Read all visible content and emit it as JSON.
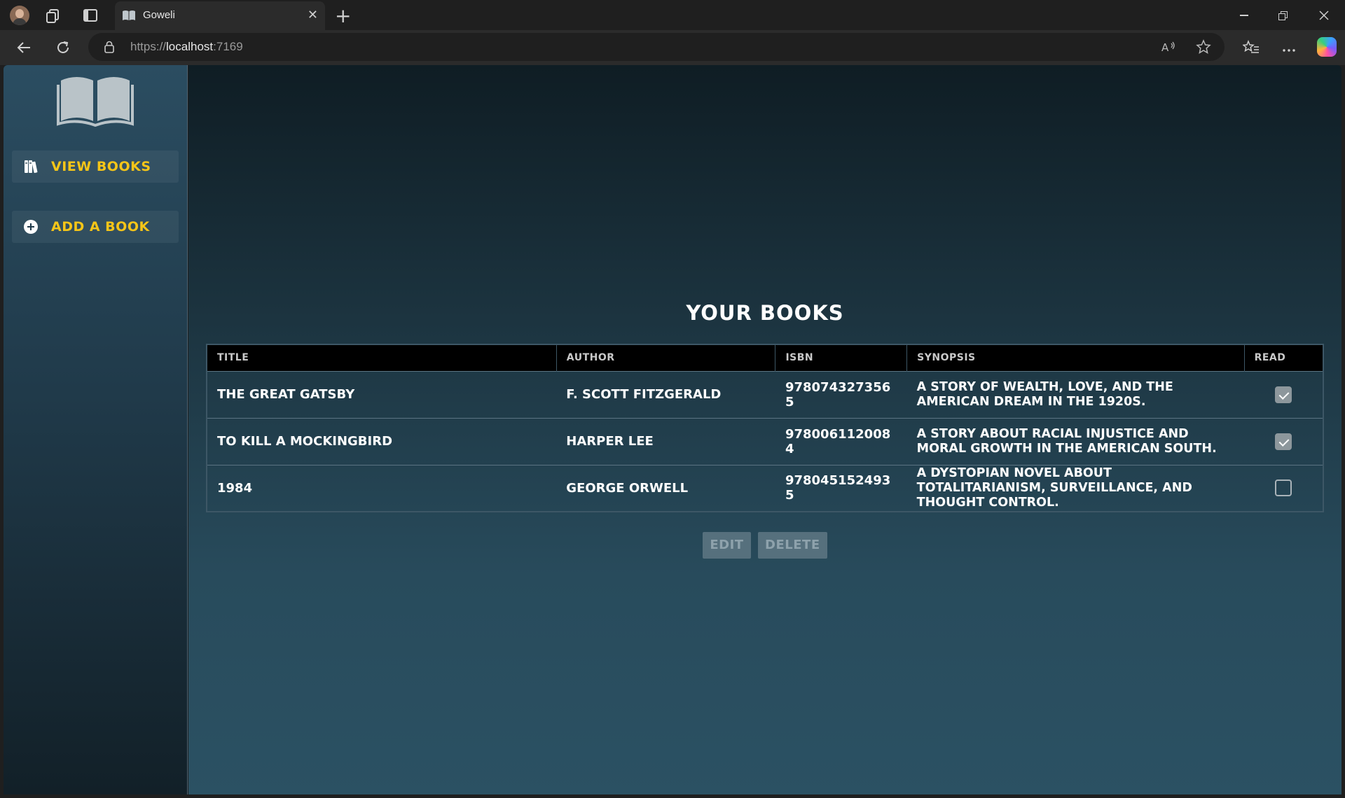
{
  "browser": {
    "tab_title": "Goweli",
    "url_scheme": "https://",
    "url_host": "localhost",
    "url_port": ":7169",
    "new_tab": "+",
    "close_tab": "✕"
  },
  "sidebar": {
    "items": [
      {
        "label": "VIEW BOOKS",
        "icon": "books-icon"
      },
      {
        "label": "ADD A BOOK",
        "icon": "plus-circle-icon"
      }
    ],
    "accent": "#f5c518"
  },
  "main": {
    "heading": "YOUR BOOKS",
    "columns": [
      "TITLE",
      "AUTHOR",
      "ISBN",
      "SYNOPSIS",
      "READ"
    ],
    "rows": [
      {
        "title": "THE GREAT GATSBY",
        "author": "F. SCOTT FITZGERALD",
        "isbn": "9780743273565",
        "synopsis": "A STORY OF WEALTH, LOVE, AND THE AMERICAN DREAM IN THE 1920S.",
        "read": true
      },
      {
        "title": "TO KILL A MOCKINGBIRD",
        "author": "HARPER LEE",
        "isbn": "9780061120084",
        "synopsis": "A STORY ABOUT RACIAL INJUSTICE AND MORAL GROWTH IN THE AMERICAN SOUTH.",
        "read": true
      },
      {
        "title": "1984",
        "author": "GEORGE ORWELL",
        "isbn": "9780451524935",
        "synopsis": "A DYSTOPIAN NOVEL ABOUT TOTALITARIANISM, SURVEILLANCE, AND THOUGHT CONTROL.",
        "read": false
      }
    ],
    "buttons": {
      "edit": "EDIT",
      "delete": "DELETE"
    }
  }
}
